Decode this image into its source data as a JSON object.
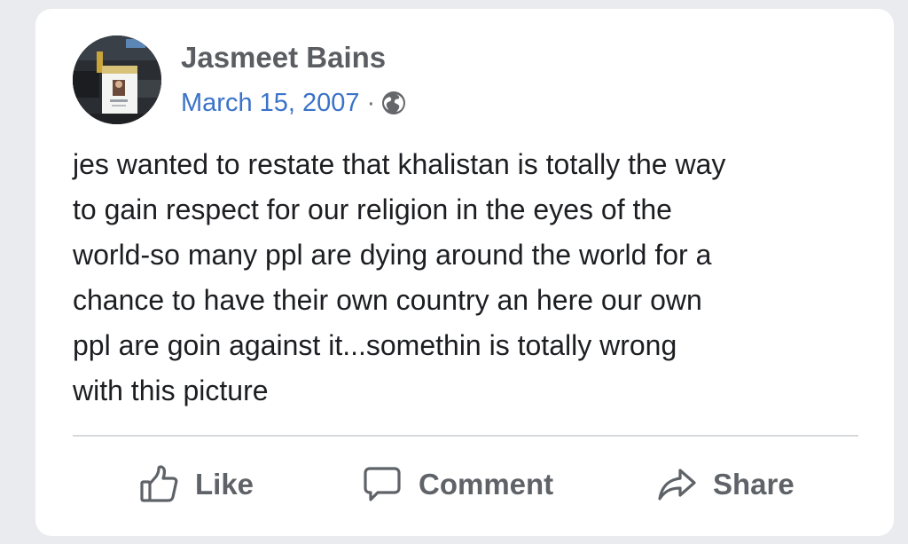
{
  "post": {
    "author": "Jasmeet Bains",
    "date": "March 15, 2007",
    "separator": "·",
    "audience_icon": "globe-icon",
    "text_lines": [
      "jes wanted to restate that khalistan is totally the way",
      "to gain respect for our religion in the eyes of the",
      "world-so many ppl are dying around the world for a",
      "chance to have their own country an here our own",
      "ppl are goin against it...somethin is totally wrong",
      "with this picture"
    ]
  },
  "actions": {
    "like": {
      "label": "Like",
      "icon": "thumbs-up-icon"
    },
    "comment": {
      "label": "Comment",
      "icon": "comment-icon"
    },
    "share": {
      "label": "Share",
      "icon": "share-arrow-icon"
    }
  },
  "colors": {
    "page_background": "#e9ebee",
    "card_background": "#ffffff",
    "author": "#5a5d61",
    "date_link": "#3b73c8",
    "body_text": "#1c1e21",
    "action_text": "#5f6368"
  }
}
